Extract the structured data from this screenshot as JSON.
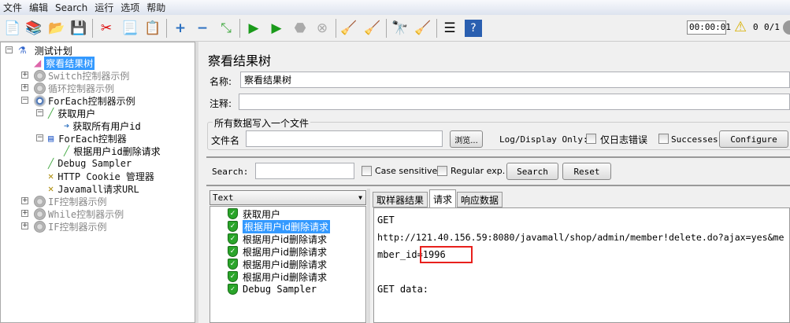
{
  "menu": [
    "文件",
    "编辑",
    "Search",
    "运行",
    "选项",
    "帮助"
  ],
  "toolbar": {
    "icons": [
      "new-icon",
      "templates-icon",
      "open-icon",
      "save-icon",
      "cut-icon",
      "copy-icon",
      "paste-icon",
      "expand-icon",
      "collapse-icon",
      "toggle-icon",
      "start-icon",
      "start-no-pause-icon",
      "stop-icon",
      "shutdown-icon",
      "clear-icon",
      "clear-all-icon",
      "search-icon",
      "reset-search-icon",
      "function-helper-icon",
      "help-icon"
    ],
    "timer": "00:00:01",
    "warnings": "0",
    "threads": "0/1"
  },
  "tree": {
    "root": "测试计划",
    "items": [
      "察看结果树",
      "Switch控制器示例",
      "循环控制器示例",
      "ForEach控制器示例",
      "获取用户",
      "获取所有用户id",
      "ForEach控制器",
      "根据用户id删除请求",
      "Debug Sampler",
      "HTTP Cookie 管理器",
      "Javamall请求URL",
      "IF控制器示例",
      "While控制器示例",
      "IF控制器示例"
    ]
  },
  "panel": {
    "title": "察看结果树",
    "name_label": "名称:",
    "name_value": "察看结果树",
    "comment_label": "注释:",
    "comment_value": "",
    "file_group": "所有数据写入一个文件",
    "file_label": "文件名",
    "file_value": "",
    "browse": "浏览...",
    "log_display": "Log/Display Only:",
    "errors_only": "仅日志错误",
    "successes": "Successes",
    "configure": "Configure"
  },
  "search": {
    "label": "Search:",
    "value": "",
    "case_sensitive": "Case sensitive",
    "regex": "Regular exp.",
    "search_btn": "Search",
    "reset_btn": "Reset"
  },
  "results": {
    "renderer": "Text",
    "items": [
      "获取用户",
      "根据用户id删除请求",
      "根据用户id删除请求",
      "根据用户id删除请求",
      "根据用户id删除请求",
      "根据用户id删除请求",
      "Debug Sampler"
    ],
    "tabs": [
      "取样器结果",
      "请求",
      "响应数据"
    ],
    "active_tab": "请求",
    "request": {
      "method": "GET",
      "url1": "http://121.40.156.59:8080/javamall/shop/admin/member!delete.do?ajax=yes&me",
      "url2_prefix": "mber_id=",
      "url2_value": "1996",
      "get_data": "GET data:"
    },
    "highlight_color": "#e8201c"
  }
}
